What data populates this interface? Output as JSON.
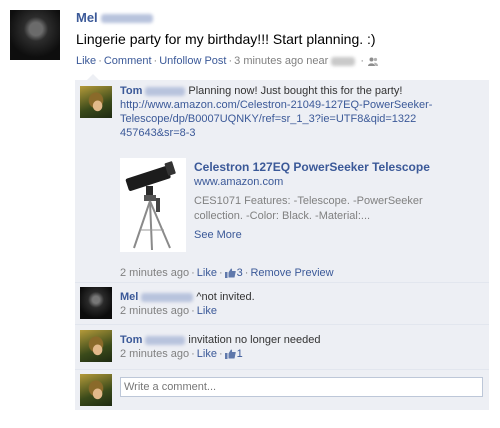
{
  "post": {
    "author_first": "Mel",
    "text": "Lingerie party for my birthday!!! Start planning. :)",
    "actions": {
      "like": "Like",
      "comment": "Comment",
      "unfollow": "Unfollow Post"
    },
    "time": "3 minutes ago near",
    "icons": {
      "avatar": "person-photo-dark",
      "audience": "people-icon"
    }
  },
  "comments": [
    {
      "author_first": "Tom",
      "text": "Planning now! Just bought this for the party!",
      "link": "http://www.amazon.com/Celestron-21049-127EQ-PowerSeeker-Telescope/dp/B0007UQNKY/ref=sr_1_3?ie=UTF8&qid=1322457643&sr=8-3",
      "link_lines": [
        "http://www.amazon.com/Celestron-21049-127EQ-PowerSeeker-",
        "Telescope/dp/B0007UQNKY/ref=sr_1_3?ie=UTF8&qid=1322",
        "457643&sr=8-3"
      ],
      "attachment": {
        "title": "Celestron 127EQ PowerSeeker Telescope",
        "domain": "www.amazon.com",
        "description_lines": [
          "CES1071 Features: -Telescope. -PowerSeeker",
          "collection. -Color: Black. -Material:..."
        ],
        "see_more": "See More"
      },
      "time": "2 minutes ago",
      "like": "Like",
      "like_count": "3",
      "remove_preview": "Remove Preview"
    },
    {
      "author_first": "Mel",
      "text": "^not invited.",
      "time": "2 minutes ago",
      "like": "Like"
    },
    {
      "author_first": "Tom",
      "text": "invitation no longer needed",
      "time": "2 minutes ago",
      "like": "Like",
      "like_count": "1"
    }
  ],
  "composer": {
    "placeholder": "Write a comment..."
  },
  "colors": {
    "link": "#3b5998",
    "comment_bg": "#edeff4",
    "meta": "#808080"
  }
}
